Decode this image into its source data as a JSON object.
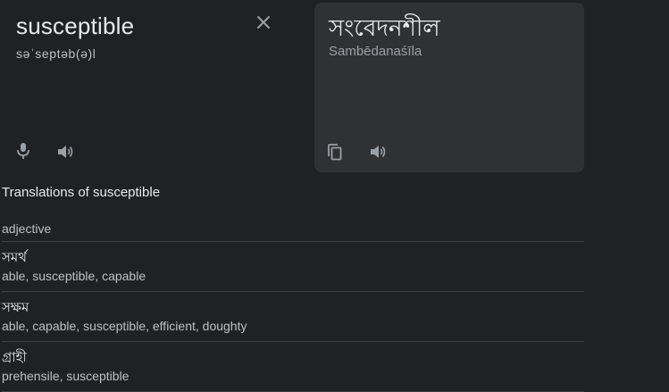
{
  "source": {
    "word": "susceptible",
    "phonetic": "səˈseptəb(ə)l"
  },
  "target": {
    "word": "সংবেদনশীল",
    "transliteration": "Sambēdanaśīla"
  },
  "translations": {
    "heading": "Translations of susceptible",
    "part_of_speech": "adjective",
    "entries": [
      {
        "word": "সমর্থ",
        "synonyms": "able, susceptible, capable"
      },
      {
        "word": "সক্ষম",
        "synonyms": "able, capable, susceptible, efficient, doughty"
      },
      {
        "word": "গ্রাহী",
        "synonyms": "prehensile, susceptible"
      }
    ]
  },
  "icons": {
    "clear": "close-icon",
    "mic": "microphone-icon",
    "speak": "speaker-icon",
    "copy": "copy-icon"
  },
  "colors": {
    "background": "#202124",
    "panel": "#303134",
    "text_primary": "#e8eaed",
    "text_secondary": "#bdc1c6",
    "icon": "#9aa0a6"
  }
}
